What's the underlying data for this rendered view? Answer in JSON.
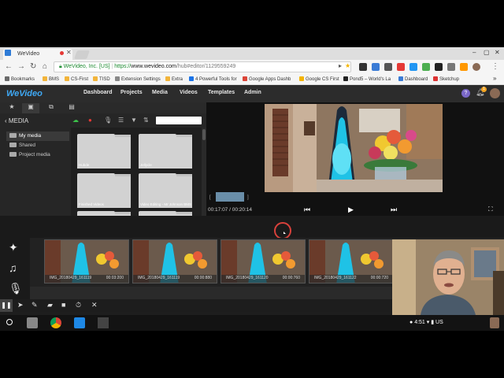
{
  "browser": {
    "tab_title": "WeVideo",
    "address": {
      "secure_label": "WeVideo, Inc. [US]",
      "scheme": "https://",
      "host": "www.wevideo.com",
      "path": "/hub#editor/1129559249"
    },
    "bookmarks": [
      {
        "label": "Bookmarks",
        "color": "#6a6a6a"
      },
      {
        "label": "BMS",
        "color": "#f2b43a"
      },
      {
        "label": "CS-First",
        "color": "#f2b43a"
      },
      {
        "label": "TISD",
        "color": "#f2b43a"
      },
      {
        "label": "Extension Settings",
        "color": "#888888"
      },
      {
        "label": "Extra",
        "color": "#f2b43a"
      },
      {
        "label": "4 Powerful Tools for",
        "color": "#1a73e8"
      },
      {
        "label": "Google Apps Dashb",
        "color": "#db4437"
      },
      {
        "label": "Google CS First",
        "color": "#f4b400"
      },
      {
        "label": "Pond5 – World's La",
        "color": "#222222"
      },
      {
        "label": "Dashboard",
        "color": "#3a7bd5"
      },
      {
        "label": "Sketchup",
        "color": "#d33"
      }
    ]
  },
  "app": {
    "logo": "WeVideo",
    "nav": [
      "Dashboard",
      "Projects",
      "Media",
      "Videos",
      "Templates",
      "Admin"
    ],
    "notification_count": "1",
    "help_label": "?"
  },
  "media": {
    "title": "MEDIA",
    "folders": [
      "My media",
      "Shared",
      "Project media"
    ],
    "grid_items": [
      "Hubde",
      "Jellycle",
      "Finished Videos",
      "Video Editing - Mr Johnson BMS"
    ]
  },
  "preview": {
    "timecode": "00:17:07 / 00:20:14"
  },
  "timeline": {
    "clips": [
      {
        "name": "IMG_20180429_161119",
        "duration": "00:03:200"
      },
      {
        "name": "IMG_20180429_161119",
        "duration": "00:00:880"
      },
      {
        "name": "IMG_20180429_161120",
        "duration": "00:00:760"
      },
      {
        "name": "IMG_20180429_161122",
        "duration": "00:00:720"
      }
    ]
  },
  "taskbar": {
    "time": "4:51",
    "lang": "US"
  },
  "colors": {
    "accent": "#3fa9f5",
    "record": "#d8413b",
    "lamp": "#1fc2e6"
  }
}
